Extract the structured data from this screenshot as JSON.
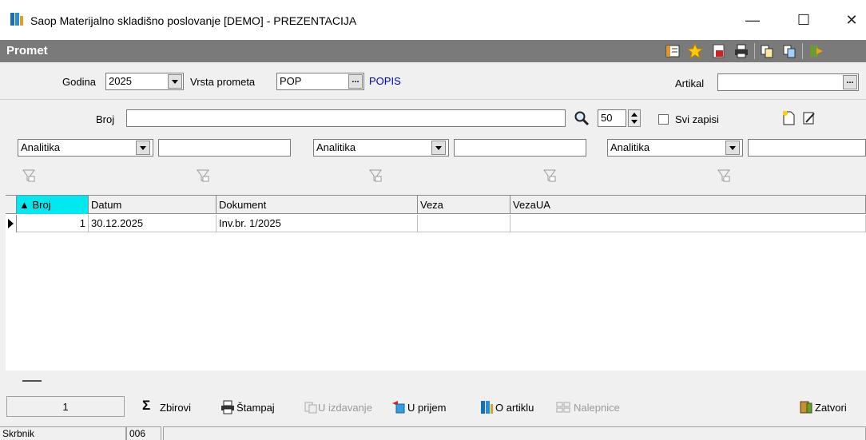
{
  "window": {
    "title": "Saop Materijalno skladišno poslovanje [DEMO] - PREZENTACIJA",
    "min_glyph": "—",
    "max_glyph": "☐",
    "close_glyph": "✕"
  },
  "header": {
    "title": "Promet",
    "toolbar_icons": [
      "columns-icon",
      "favorite-star-icon",
      "export-icon",
      "print-icon",
      "copy-icon",
      "paste-icon",
      "exit-icon"
    ]
  },
  "filters": {
    "godina_label": "Godina",
    "godina_value": "2025",
    "vrsta_label": "Vrsta prometa",
    "vrsta_value": "POP",
    "vrsta_desc": "POPIS",
    "artikal_label": "Artikal",
    "artikal_value": "",
    "broj_label": "Broj",
    "broj_value": "",
    "limit_value": "50",
    "svi_zapisi_label": "Svi zapisi",
    "analitika": [
      "Analitika",
      "Analitika",
      "Analitika"
    ]
  },
  "grid": {
    "columns": [
      "▲ Broj",
      "Datum",
      "Dokument",
      "Veza",
      "VezaUA"
    ],
    "rows": [
      {
        "broj": "1",
        "datum": "30.12.2025",
        "dokument": "Inv.br. 1/2025",
        "veza": "",
        "vezaua": ""
      }
    ]
  },
  "bottom": {
    "count": "1",
    "zbirovi": "Zbirovi",
    "stampaj": "Štampaj",
    "u_izdavanje": "U izdavanje",
    "u_prijem": "U prijem",
    "o_artiklu": "O artiklu",
    "nalepnice": "Nalepnice",
    "zatvori": "Zatvori"
  },
  "status": {
    "user": "Skrbnik",
    "code": "006",
    "message": ""
  },
  "colors": {
    "header_bg": "#7a7a7a",
    "sorted_col": "#00e8f0",
    "link_blue": "#0000cc"
  }
}
